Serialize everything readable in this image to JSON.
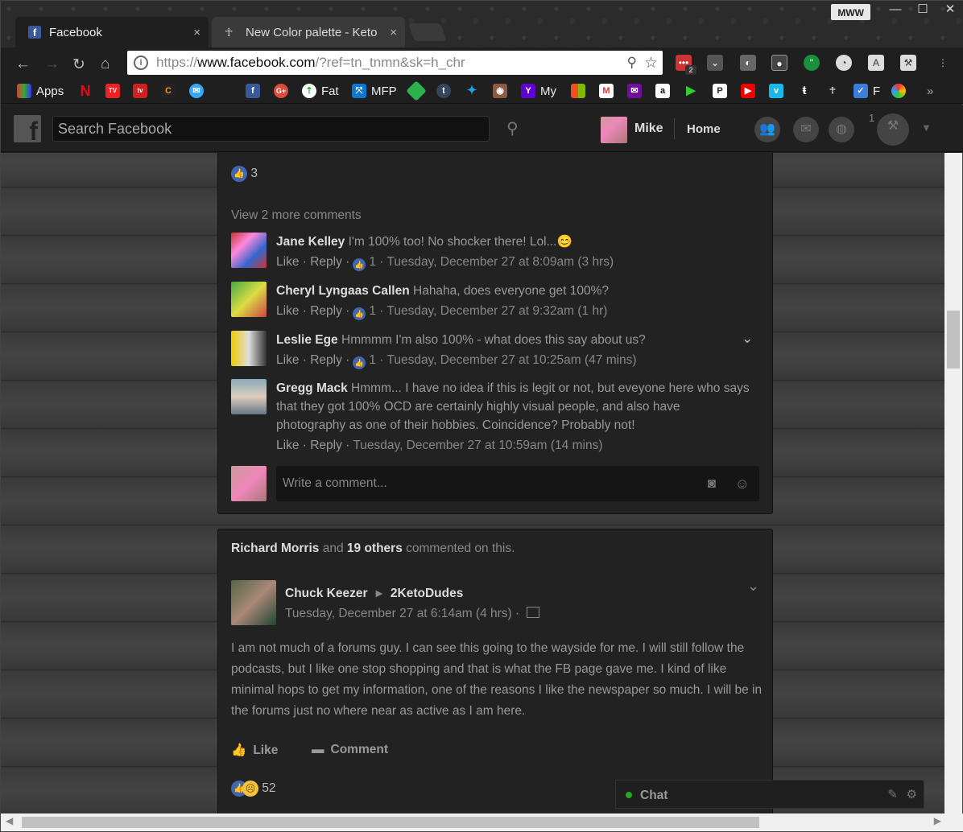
{
  "browser": {
    "tabs": [
      {
        "title": "Facebook",
        "close": "×"
      },
      {
        "title": "New Color palette - Keto",
        "close": "×"
      }
    ],
    "profile": "MWW",
    "window_controls": {
      "minimize": "—",
      "maximize": "☐",
      "close": "✕"
    },
    "url": {
      "scheme": "https://",
      "host": "www.facebook.com",
      "path": "/?ref=tn_tnmn&sk=h_chr"
    },
    "extension_badge": "2",
    "bookmarks": [
      "Apps",
      "Fat",
      "MFP",
      "My",
      "F"
    ],
    "bookmarks_overflow": "»"
  },
  "facebook": {
    "search_placeholder": "Search Facebook",
    "user": "Mike",
    "home": "Home",
    "notification_count": "1"
  },
  "post1": {
    "like_count": "3",
    "view_more": "View 2 more comments",
    "comments": [
      {
        "author": "Jane Kelley",
        "text": "I'm 100% too! No shocker there! Lol...😊",
        "actions": "Like · Reply ·",
        "likes": "1",
        "time": "· Tuesday, December 27 at 8:09am (3 hrs)"
      },
      {
        "author": "Cheryl Lyngaas Callen",
        "text": "Hahaha, does everyone get 100%?",
        "actions": "Like · Reply ·",
        "likes": "1",
        "time": "· Tuesday, December 27 at 9:32am (1 hr)"
      },
      {
        "author": "Leslie Ege",
        "text": "Hmmmm I'm also 100% - what does this say about us?",
        "actions": "Like · Reply ·",
        "likes": "1",
        "time": "· Tuesday, December 27 at 10:25am (47 mins)"
      },
      {
        "author": "Gregg Mack",
        "text": "Hmmm... I have no idea if this is legit or not, but eveyone here who says that they got 100% OCD are certainly highly visual people, and also have photography as one of their hobbies. Coincidence? Probably not!",
        "actions": "Like · Reply ·",
        "likes": "",
        "time": "Tuesday, December 27 at 10:59am (14 mins)"
      }
    ],
    "write_placeholder": "Write a comment..."
  },
  "post2": {
    "story_name1": "Richard Morris",
    "story_and": "and",
    "story_name2": "19 others",
    "story_suffix": "commented on this.",
    "author": "Chuck Keezer",
    "group": "2KetoDudes",
    "timestamp": "Tuesday, December 27 at 6:14am (4 hrs) ·",
    "body": "I am not much of a forums guy. I can see this going to the wayside for me. I will still follow the podcasts, but I like one stop shopping and that is what the FB page gave me. I kind of like minimal hops to get my information, one of the reasons I like the newspaper so much. I will be in the forums just no where near as active as I am here.",
    "like_label": "Like",
    "comment_label": "Comment",
    "reaction_count": "52"
  },
  "chat": {
    "label": "Chat"
  },
  "colors": {
    "fb_blue": "#4267b2",
    "background": "#3e3e3e",
    "card": "#222222"
  }
}
